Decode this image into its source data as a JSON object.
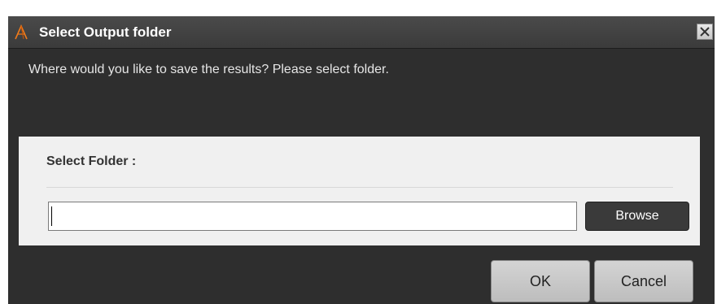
{
  "dialog": {
    "title": "Select Output folder",
    "prompt": "Where would you like to save the results? Please select folder."
  },
  "panel": {
    "label": "Select Folder :",
    "folder_input_value": "",
    "browse_label": "Browse"
  },
  "buttons": {
    "ok_label": "OK",
    "cancel_label": "Cancel"
  },
  "icons": {
    "app": "app-logo-icon",
    "close": "close-icon"
  },
  "colors": {
    "dialog_background": "#2e2e2e",
    "titlebar": "#434343",
    "panel_background": "#f0f0f0",
    "browse_button": "#3a3a3a",
    "accent": "#f07a1a"
  }
}
